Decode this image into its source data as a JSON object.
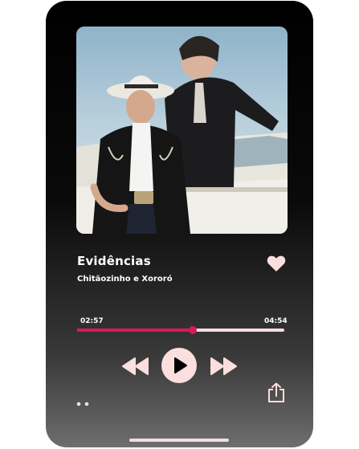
{
  "player": {
    "cover_alt": "Album cover",
    "title": "Evidências",
    "artist": "Chitãozinho e Xororó",
    "liked": true,
    "time_elapsed": "02:57",
    "time_total": "04:54",
    "progress": 0.56
  },
  "controls": {
    "rewind_icon": "rewind-icon",
    "play_icon": "play-icon",
    "forward_icon": "fast-forward-icon",
    "more_icon": "more-dots-icon",
    "share_icon": "share-icon",
    "heart_icon": "heart-icon"
  },
  "colors": {
    "accent": "#d8195a",
    "track": "#f6dfdf",
    "play_button": "#fbdede",
    "icon": "#fbdede"
  }
}
